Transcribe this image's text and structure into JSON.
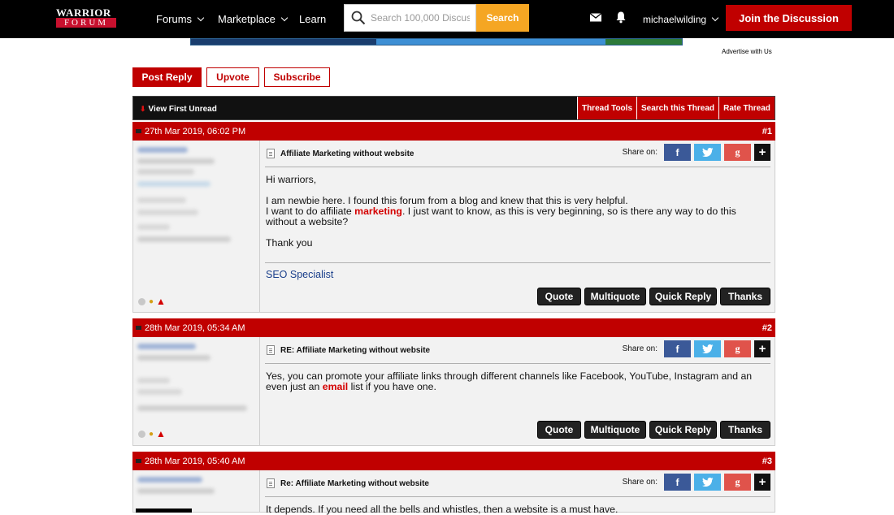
{
  "header": {
    "logo_line1": "WARRIOR",
    "logo_line2": "FORUM",
    "nav": [
      {
        "label": "Forums",
        "has_dropdown": true
      },
      {
        "label": "Marketplace",
        "has_dropdown": true
      },
      {
        "label": "Learn",
        "has_dropdown": false
      }
    ],
    "search": {
      "placeholder": "Search 100,000 Discus",
      "button_label": "Search"
    },
    "username": "michaelwilding",
    "join_label": "Join the Discussion"
  },
  "advertise_label": "Advertise with Us",
  "actions": {
    "post_reply": "Post Reply",
    "upvote": "Upvote",
    "subscribe": "Subscribe"
  },
  "tools_bar": {
    "view_first_unread": "View First Unread",
    "thread_tools": "Thread Tools",
    "search_thread": "Search this Thread",
    "rate_thread": "Rate Thread"
  },
  "share_label": "Share on:",
  "post_buttons": {
    "quote": "Quote",
    "multiquote": "Multiquote",
    "quick_reply": "Quick Reply",
    "thanks": "Thanks"
  },
  "posts": [
    {
      "date": "27th Mar 2019, 06:02 PM",
      "number": "#1",
      "title": "Affiliate Marketing without website",
      "greeting": "Hi warriors,",
      "p1": "I am newbie here. I found this forum from a blog and knew that this is very helpful.",
      "p2_before": "I want to do affiliate ",
      "p2_highlight": "marketing",
      "p2_after": ". I just want to know, as this is very beginning, so is there any way to do this without a website?",
      "closing": "Thank you",
      "signature": "SEO Specialist"
    },
    {
      "date": "28th Mar 2019, 05:34 AM",
      "number": "#2",
      "title": "RE: Affiliate Marketing without website",
      "text_before": "Yes, you can promote your affiliate links through different channels like Facebook, YouTube, Instagram and an even just an ",
      "text_highlight": "email",
      "text_after": " list if you have one."
    },
    {
      "date": "28th Mar 2019, 05:40 AM",
      "number": "#3",
      "title": "Re: Affiliate Marketing without website",
      "text": "It depends. If you need all the bells and whistles, then a website is a must have."
    }
  ],
  "colors": {
    "brand_red": "#c00000",
    "search_orange": "#f5a623",
    "facebook": "#3b5998",
    "twitter": "#4bb0e8",
    "google_plus": "#e0534b",
    "link_blue": "#1a3f8b"
  },
  "icons": [
    "search-icon",
    "mail-icon",
    "bell-icon",
    "chevron-down-icon",
    "document-icon",
    "facebook-icon",
    "twitter-icon",
    "google-plus-icon",
    "plus-icon",
    "warning-icon",
    "reputation-icon",
    "offline-status-icon"
  ]
}
